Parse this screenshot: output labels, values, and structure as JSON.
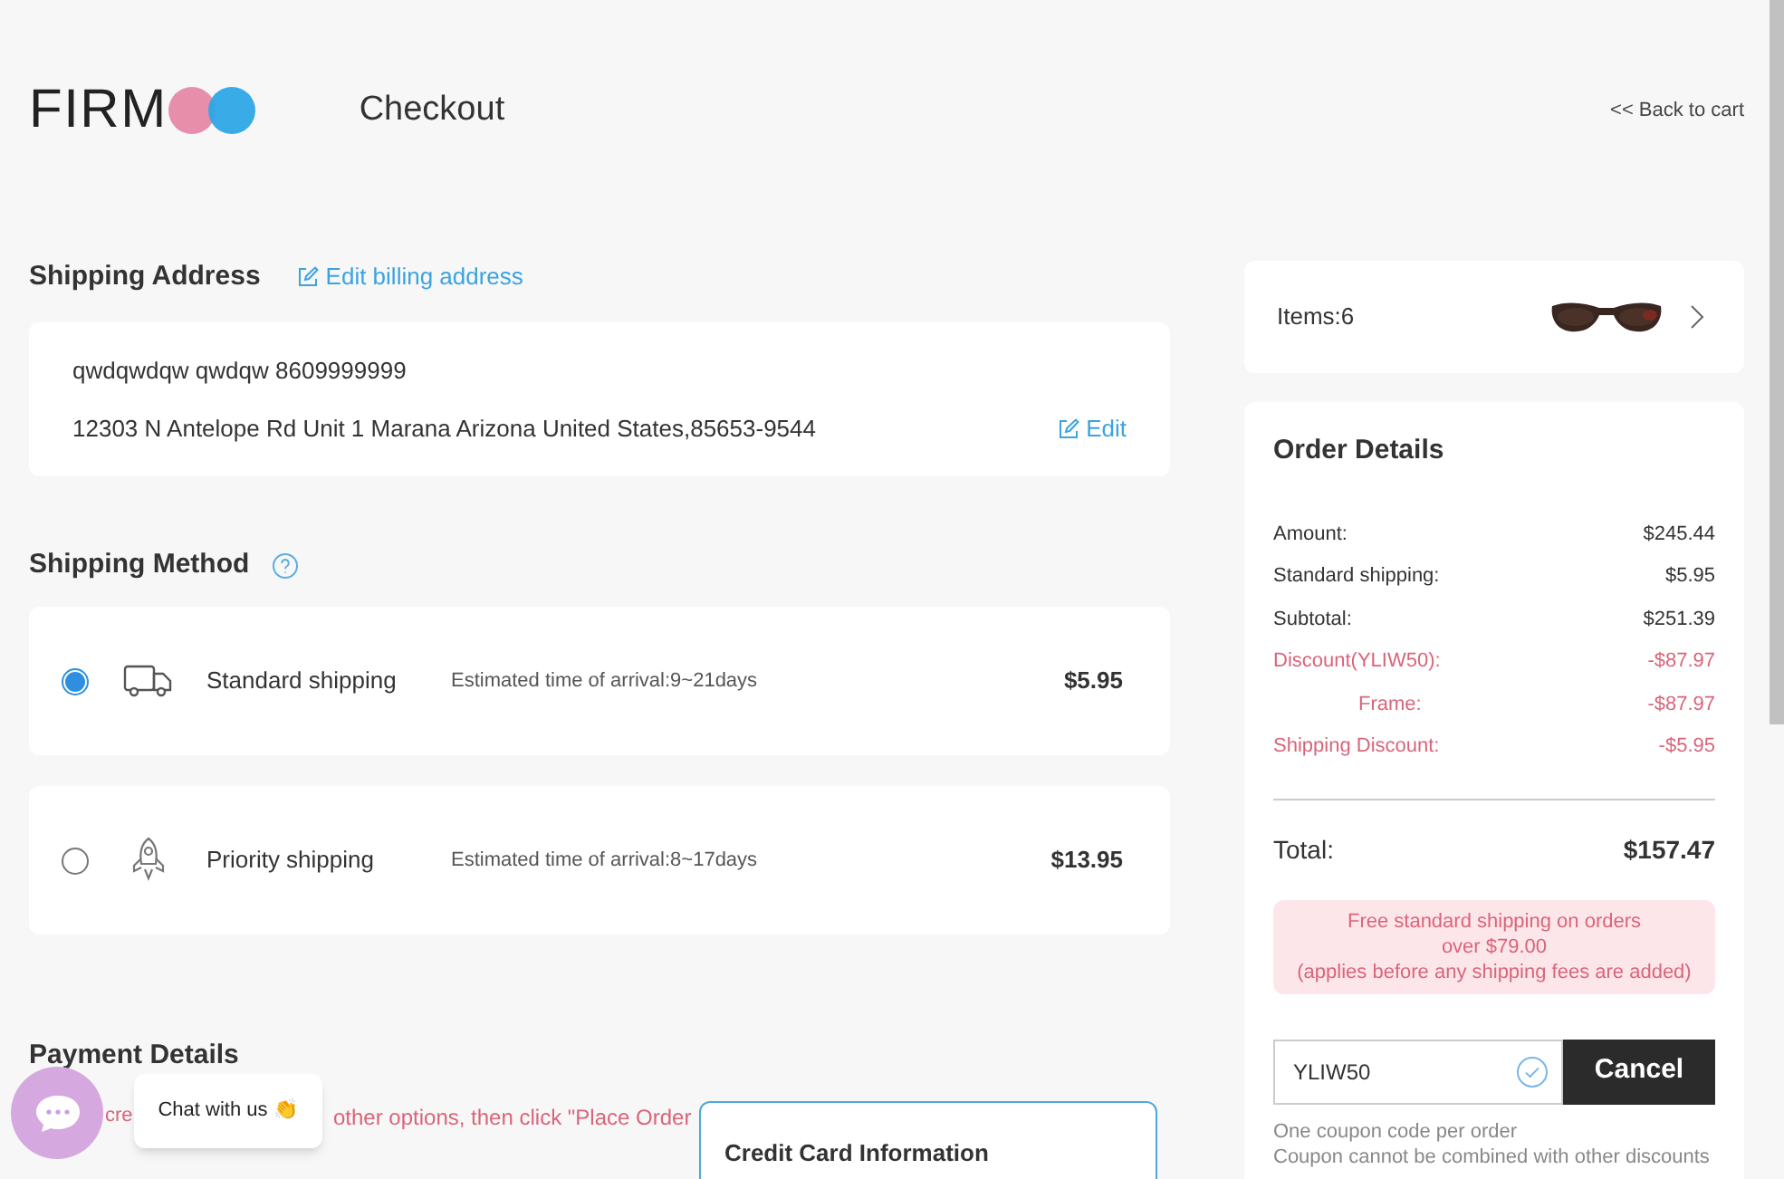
{
  "header": {
    "logo": "FIRM",
    "title": "Checkout",
    "back_link": "<< Back to cart"
  },
  "shipping_address": {
    "heading": "Shipping Address",
    "edit_billing": "Edit billing address",
    "name_line": "qwdqwdqw qwdqw 8609999999",
    "address_line": "12303 N Antelope Rd Unit 1 Marana Arizona United States,85653-9544",
    "edit": "Edit"
  },
  "shipping_method": {
    "heading": "Shipping Method",
    "options": [
      {
        "kind": "truck",
        "name": "Standard shipping",
        "eta": "Estimated time of arrival:9~21days",
        "price": "$5.95",
        "selected": true
      },
      {
        "kind": "rocket",
        "name": "Priority shipping",
        "eta": "Estimated time of arrival:8~17days",
        "price": "$13.95",
        "selected": false
      }
    ]
  },
  "payment": {
    "heading": "Payment Details",
    "note_parts": [
      "cre",
      "other options, then click \"Place Order"
    ],
    "card_box_title": "Credit Card Information"
  },
  "chat": {
    "label": "Chat with us 👏"
  },
  "items": {
    "label": "Items:6"
  },
  "order_details": {
    "heading": "Order Details",
    "rows": [
      {
        "kind": "plain",
        "label": "Amount:",
        "value": "$245.44"
      },
      {
        "kind": "plain",
        "label": "Standard shipping:",
        "value": "$5.95"
      },
      {
        "kind": "plain",
        "label": "Subtotal:",
        "value": "$251.39"
      },
      {
        "kind": "discount",
        "label": "Discount(YLIW50):",
        "value": "-$87.97"
      },
      {
        "kind": "sub",
        "label": "Frame:",
        "value": "-$87.97"
      },
      {
        "kind": "discount",
        "label": "Shipping Discount:",
        "value": "-$5.95"
      }
    ],
    "total_label": "Total:",
    "total_value": "$157.47",
    "notice_lines": [
      "Free standard shipping on orders",
      "over $79.00",
      "(applies before any shipping fees are added)"
    ],
    "coupon_value": "YLIW50",
    "coupon_button": "Cancel",
    "coupon_notes": [
      "One coupon code per order",
      "Coupon cannot be combined with other discounts"
    ]
  }
}
